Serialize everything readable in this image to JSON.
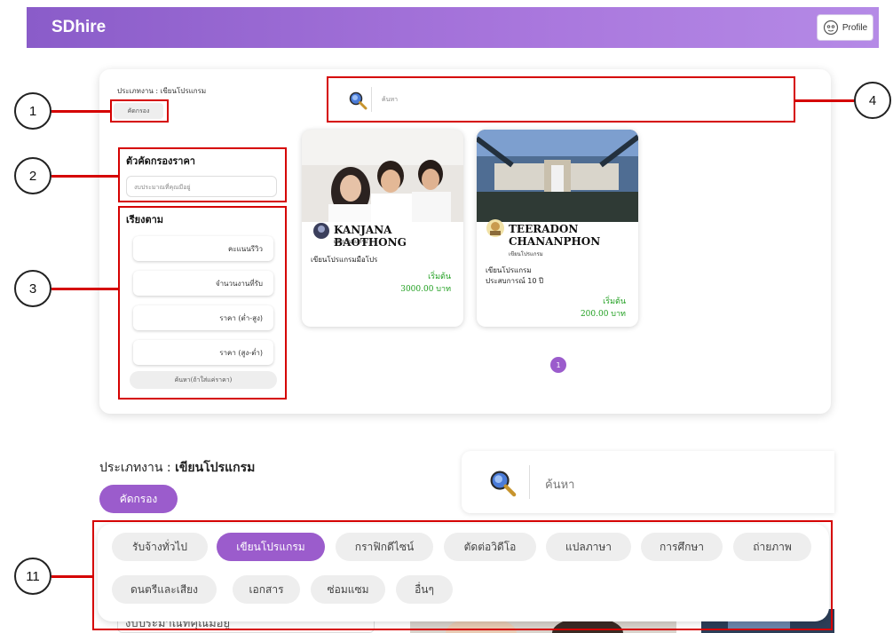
{
  "header": {
    "brand": "SDhire",
    "profile_label": "Profile"
  },
  "top": {
    "job_type": "ประเภทงาน : เขียนโปรแกรม",
    "filter_label": "คัดกรอง",
    "search_placeholder": "ค้นหา",
    "price_filter_title": "ตัวคัดกรองราคา",
    "budget_placeholder": "งบประมาณที่คุณมีอยู่",
    "sort_title": "เรียงตาม",
    "sort_options": [
      "คะแนนรีวิว",
      "จำนวนงานที่รับ",
      "ราคา (ต่ำ-สูง)",
      "ราคา (สูง-ต่ำ)"
    ],
    "search_price_only": "ค้นหา(ถ้าใส่แค่ราคา)",
    "page_number": "1"
  },
  "cards": [
    {
      "name": "KANJANA BAOTHONG",
      "category": "เขียนโปรแกรม",
      "description": "เขียนโปรแกรมมือโปร",
      "start_label": "เริ่มต้น",
      "price": "3000.00 บาท"
    },
    {
      "name_line1": "TEERADON",
      "name_line2": "CHANANPHON",
      "category": "เขียนโปรแกรม",
      "desc_line1": "เขียนโปรแกรม",
      "desc_line2": "ประสบการณ์ 10 ปี",
      "start_label": "เริ่มต้น",
      "price": "200.00 บาท"
    }
  ],
  "bottom": {
    "job_type_label": "ประเภทงาน : ",
    "job_type_value": "เขียนโปรแกรม",
    "filter_label": "คัดกรอง",
    "search_placeholder": "ค้นหา",
    "categories_row1": [
      "รับจ้างทั่วไป",
      "เขียนโปรแกรม",
      "กราฟิกดีไซน์",
      "ตัดต่อวิดีโอ",
      "แปลภาษา",
      "การศึกษา",
      "ถ่ายภาพ"
    ],
    "categories_row2": [
      "ดนตรีและเสียง",
      "เอกสาร",
      "ซ่อมแซม",
      "อื่นๆ"
    ],
    "active_category": "เขียนโปรแกรม",
    "cutoff_text": "งบประมาณที่คุณมีอยู่"
  },
  "callouts": [
    "1",
    "2",
    "3",
    "4",
    "11"
  ],
  "colors": {
    "accent": "#9b5ccc",
    "highlight": "#d50000",
    "price": "#22a022"
  }
}
